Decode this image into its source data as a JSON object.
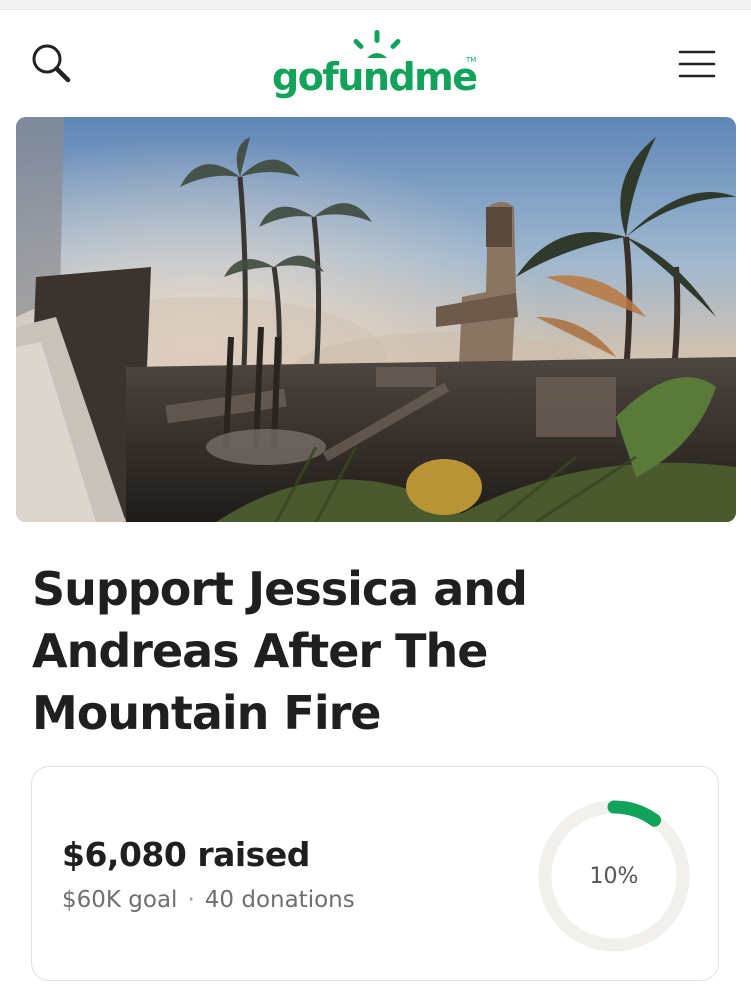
{
  "header": {
    "logo_text": "gofundme",
    "logo_tm": "TM",
    "brand_color": "#12a35a",
    "search_icon": "search-icon",
    "menu_icon": "hamburger-menu-icon"
  },
  "campaign": {
    "title": "Support Jessica and Andreas After The Mountain Fire",
    "raised_text": "$6,080 raised",
    "goal_text": "$60K goal",
    "separator": "·",
    "donations_text": "40 donations",
    "progress_fraction": 0.1,
    "progress_label": "10%",
    "progress_color": "#12a35a",
    "track_color": "#f1f0ea"
  }
}
